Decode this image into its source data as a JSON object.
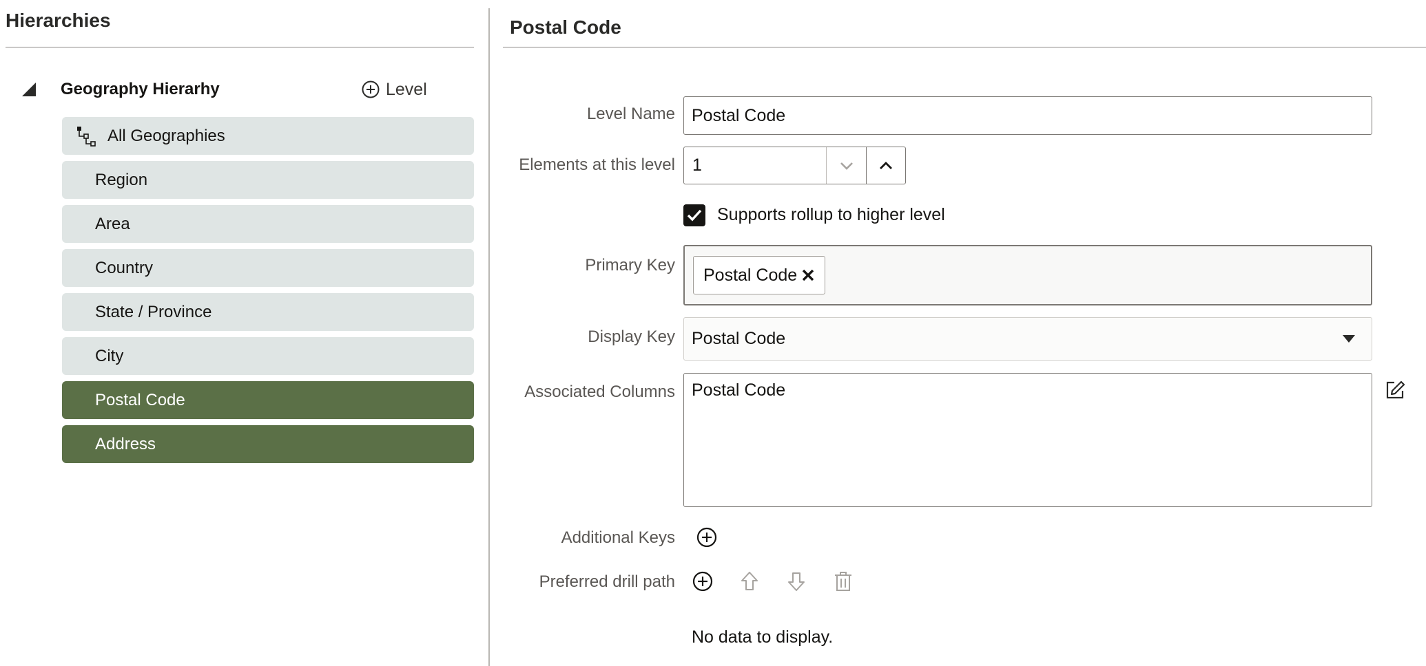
{
  "left": {
    "title": "Hierarchies",
    "hierarchy_name": "Geography Hierarhy",
    "add_level_label": "Level",
    "levels": [
      {
        "label": "All Geographies",
        "selected": false
      },
      {
        "label": "Region",
        "selected": false
      },
      {
        "label": "Area",
        "selected": false
      },
      {
        "label": "Country",
        "selected": false
      },
      {
        "label": "State / Province",
        "selected": false
      },
      {
        "label": "City",
        "selected": false
      },
      {
        "label": "Postal Code",
        "selected": true
      },
      {
        "label": "Address",
        "selected": true
      }
    ]
  },
  "right": {
    "title": "Postal Code",
    "level_name": {
      "label": "Level Name",
      "value": "Postal Code"
    },
    "elements": {
      "label": "Elements at this level",
      "value": "1"
    },
    "rollup": {
      "label": "Supports rollup to higher level",
      "checked": true
    },
    "primary_key": {
      "label": "Primary Key",
      "chips": [
        "Postal Code"
      ]
    },
    "display_key": {
      "label": "Display Key",
      "value": "Postal Code"
    },
    "associated_columns": {
      "label": "Associated Columns",
      "value": "Postal Code"
    },
    "additional_keys": {
      "label": "Additional Keys"
    },
    "drill_path": {
      "label": "Preferred drill path",
      "empty_text": "No data to display."
    }
  },
  "icons": {
    "toggle": "collapse-triangle-icon",
    "add": "plus-circle-icon",
    "hierarchy_root": "hierarchy-icon",
    "chevron_down": "chevron-down-icon",
    "chevron_up": "chevron-up-icon",
    "check": "check-icon",
    "remove": "close-icon",
    "dropdown": "caret-down-icon",
    "edit": "edit-icon",
    "move_up": "arrow-up-icon",
    "move_down": "arrow-down-icon",
    "delete": "trash-icon"
  },
  "colors": {
    "selected_level_bg": "#5b7047",
    "level_bg": "#dfe5e4"
  }
}
